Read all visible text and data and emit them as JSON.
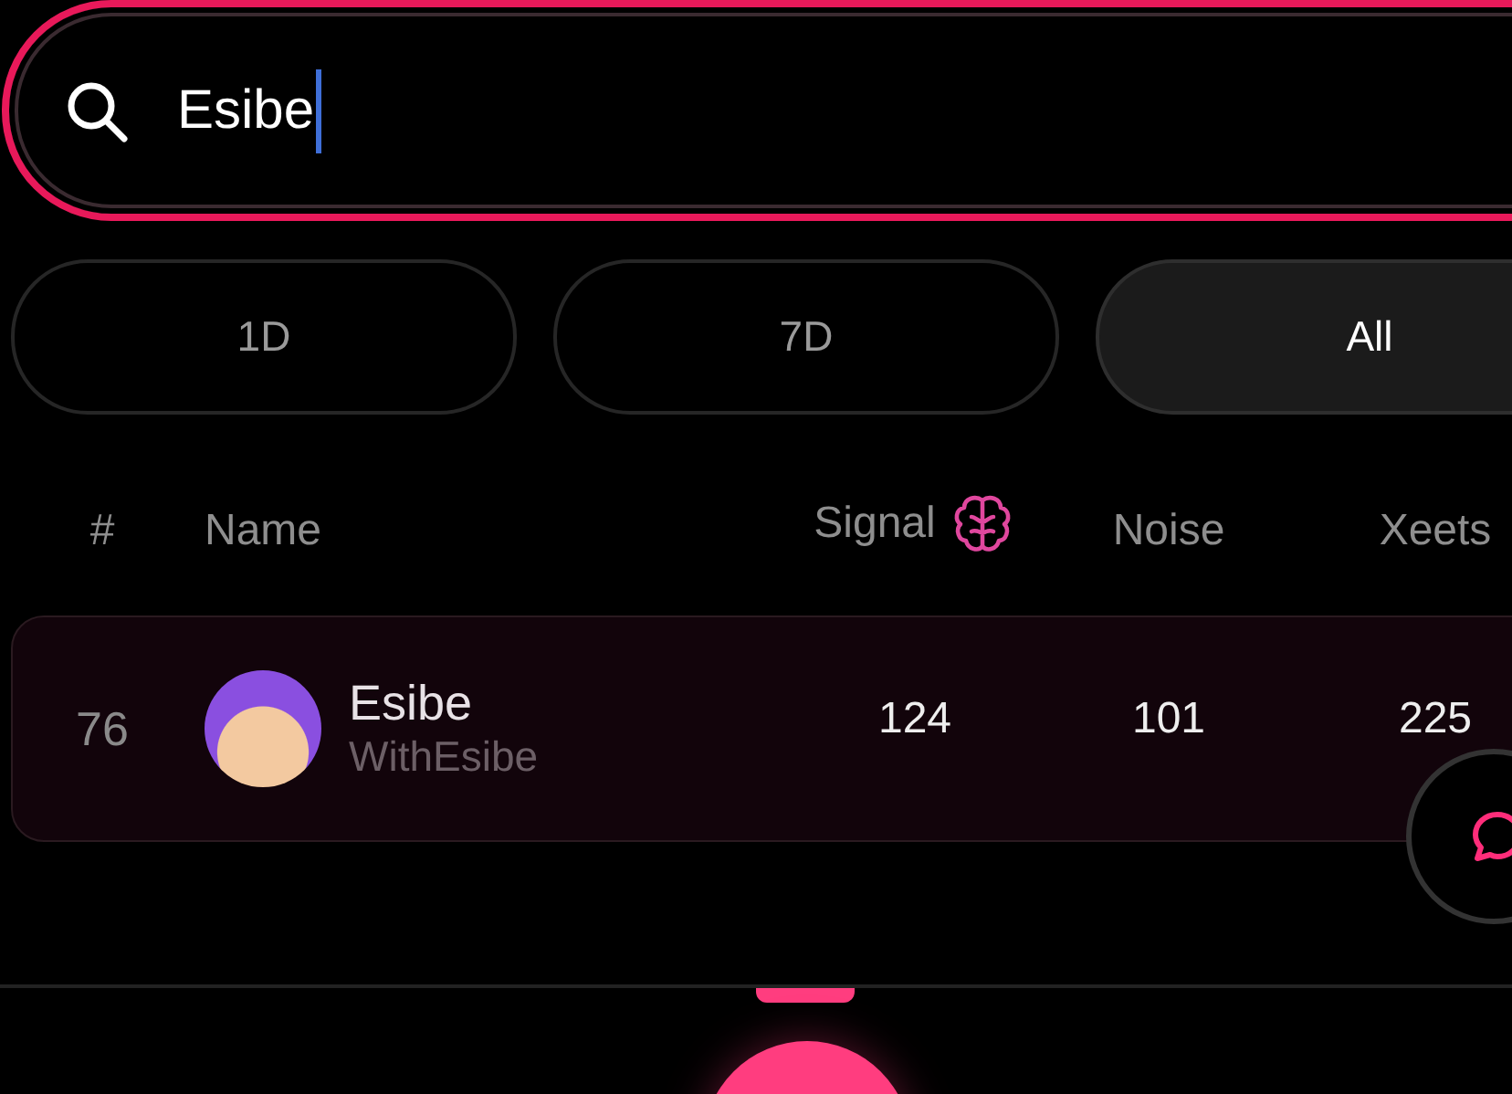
{
  "search": {
    "value": "Esibe"
  },
  "filters": [
    {
      "label": "1D",
      "selected": false
    },
    {
      "label": "7D",
      "selected": false
    },
    {
      "label": "All",
      "selected": true
    }
  ],
  "table": {
    "columns": [
      {
        "label": "#",
        "kind": "text"
      },
      {
        "label": "Name",
        "kind": "text"
      },
      {
        "label": "Signal",
        "kind": "with_icon"
      },
      {
        "label": "Noise",
        "kind": "text"
      },
      {
        "label": "Xeets",
        "kind": "text"
      }
    ],
    "rows": [
      {
        "rank": "76",
        "name": "Esibe",
        "handle": "WithEsibe",
        "signal": "124",
        "noise": "101",
        "xeets": "225"
      }
    ]
  }
}
